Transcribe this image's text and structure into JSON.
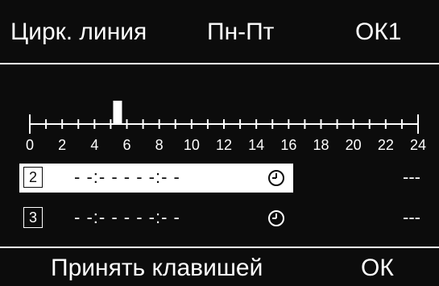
{
  "header": {
    "title": "Цирк. линия",
    "days": "Пн-Пт",
    "slot": "ОК1"
  },
  "timeline": {
    "tick_labels": [
      "0",
      "2",
      "4",
      "6",
      "8",
      "10",
      "12",
      "14",
      "16",
      "18",
      "20",
      "22",
      "24"
    ],
    "active_marker_hour": 5.5,
    "range_hours": [
      0,
      24
    ]
  },
  "rows": [
    {
      "number": "2",
      "times": "- -:- -  -  - -:- -",
      "value": "---",
      "selected": true
    },
    {
      "number": "3",
      "times": "- -:- -  -  - -:- -",
      "value": "---",
      "selected": false
    }
  ],
  "footer": {
    "prompt": "Принять клавишей",
    "key": "ОК"
  },
  "colors": {
    "background": "#0c0c0c",
    "foreground": "#ffffff"
  }
}
